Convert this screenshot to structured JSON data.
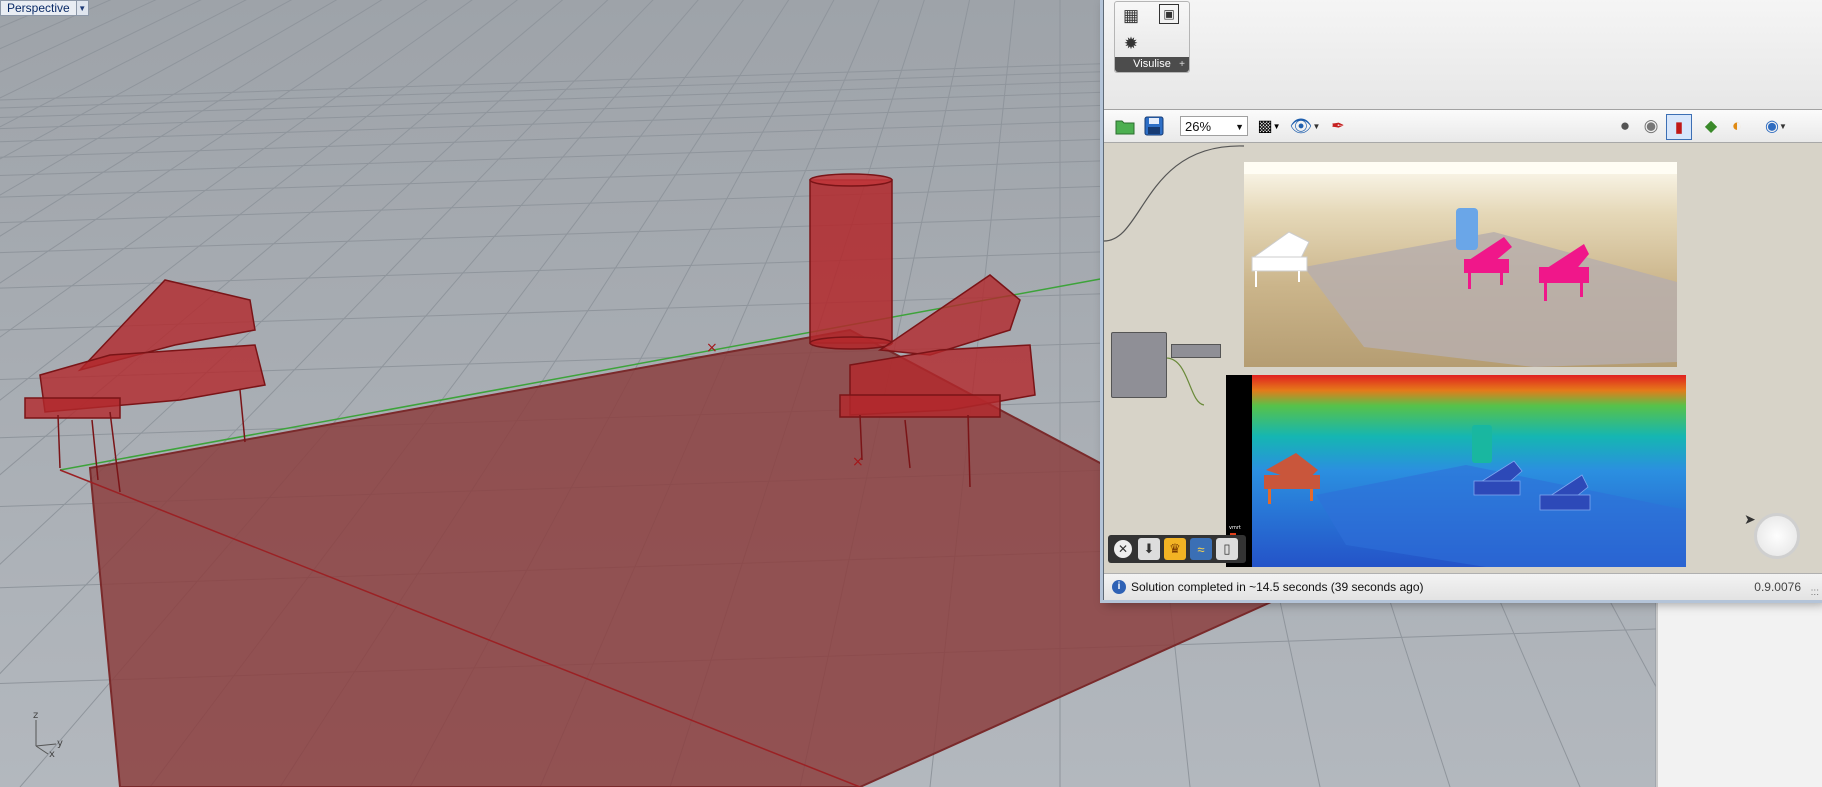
{
  "viewport": {
    "label": "Perspective",
    "dropdown_icon": "triangle-down-icon",
    "axis": {
      "z": "z",
      "y": "y",
      "x": "x"
    },
    "colors": {
      "background": "#a5aab0",
      "grid": "#8d939a",
      "plane": "#8c3f40",
      "object": "#b3282c",
      "axis_green": "#3da33a"
    }
  },
  "grasshopper": {
    "ribbon": {
      "group_label": "Visulise",
      "group_expand": "+",
      "icons": [
        "graph-icon",
        "panel-icon",
        "sun-icon"
      ]
    },
    "toolbar": {
      "zoom_value": "26%",
      "icons_left": [
        "open-file-icon",
        "save-icon"
      ],
      "icons_mid": [
        "zoom-extents-icon",
        "eye-icon",
        "sketch-pen-icon"
      ],
      "icons_right": [
        "preview-off-icon",
        "preview-wireframe-icon",
        "preview-shaded-icon",
        "selected-preview-icon",
        "material-sphere-icon",
        "globe-icon"
      ]
    },
    "canvas": {
      "render_colors": [
        "#ffffff",
        "#f0178a",
        "#6aa6e8"
      ],
      "heat_legend": "vmrt"
    },
    "dock": {
      "icons": [
        "close-icon",
        "download-icon",
        "ladybug-icon",
        "python-icon",
        "phone-icon"
      ]
    },
    "status": {
      "info_icon": "i",
      "message": "Solution completed in ~14.5 seconds (39 seconds ago)",
      "version": "0.9.0076",
      "grip": ":::"
    }
  }
}
